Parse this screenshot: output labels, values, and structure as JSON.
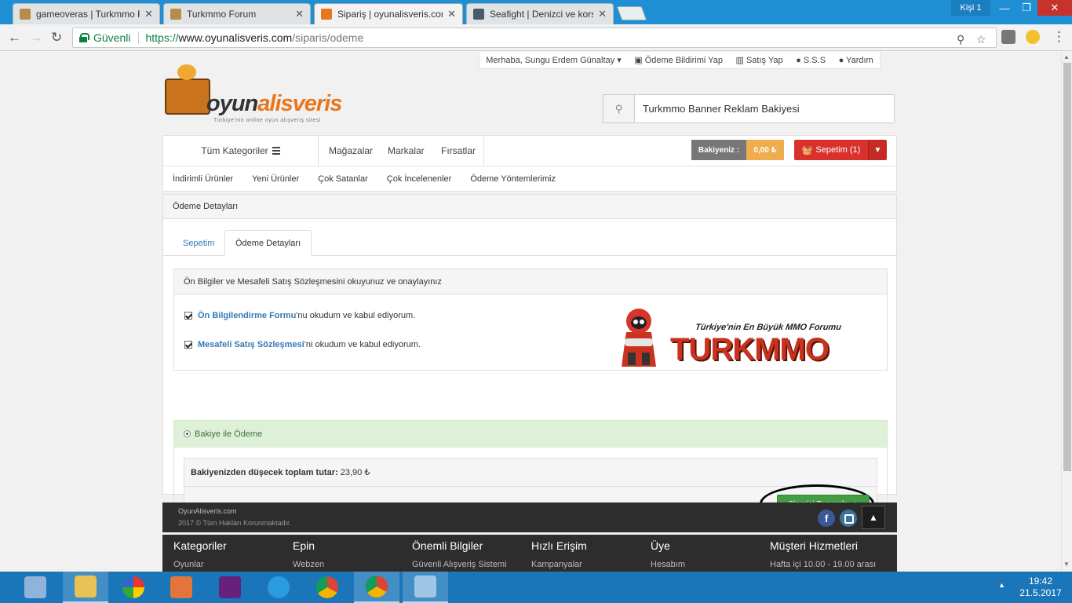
{
  "browser": {
    "tabs": [
      {
        "label": "gameoveras | Turkmmo F",
        "active": false,
        "favicon_color": "#b78c4a"
      },
      {
        "label": "Turkmmo Forum",
        "active": false,
        "favicon_color": "#b78c4a"
      },
      {
        "label": "Sipariş | oyunalisveris.com",
        "active": true,
        "favicon_color": "#e8761d"
      },
      {
        "label": "Seafight | Denizci ve kors",
        "active": false,
        "favicon_color": "#4a5a6a"
      }
    ],
    "profile_label": "Kişi 1",
    "secure_label": "Güvenli",
    "url_scheme": "https://",
    "url_host": "www.oyunalisveris.com",
    "url_path": "/siparis/odeme"
  },
  "site": {
    "top_links": [
      "Merhaba, Sungu Erdem Günaltay ▾",
      "▣ Ödeme Bildirimi Yap",
      "▥ Satış Yap",
      "● S.S.S",
      "● Yardım"
    ],
    "logo": {
      "word_a": "oyun",
      "word_b": "alisveris",
      "tagline": "Türkiye'nin online oyun alışveriş sitesi"
    },
    "search": {
      "value": "Turkmmo Banner Reklam Bakiyesi"
    },
    "nav": {
      "categories_label": "Tüm Kategoriler",
      "links": [
        "Mağazalar",
        "Markalar",
        "Fırsatlar"
      ],
      "balance_label": "Bakiyeniz :",
      "balance_value": "0,00 ₺",
      "cart_label": "Sepetim (1)"
    },
    "subnav": [
      "İndirimli Ürünler",
      "Yeni Ürünler",
      "Çok Satanlar",
      "Çok İncelenenler",
      "Ödeme Yöntemlerimiz"
    ]
  },
  "panel": {
    "heading": "Ödeme Detayları",
    "tabs": {
      "cart": "Sepetim",
      "details": "Ödeme Detayları"
    },
    "agreement": {
      "heading": "Ön Bilgiler ve Mesafeli Satış Sözleşmesini okuyunuz ve onaylayınız",
      "row1_link": "Ön Bilgilendirme Formu",
      "row1_text": "'nu okudum ve kabul ediyorum.",
      "row2_link": "Mesafeli Satış Sözleşmesi",
      "row2_text": "'ni okudum ve kabul ediyorum."
    },
    "banner": {
      "tagline": "Türkiye'nin En Büyük MMO Forumu",
      "word": "TURKMMO"
    },
    "payment": {
      "method_label": "Bakiye ile Ödeme",
      "total_label": "Bakiyenizden düşecek toplam tutar:",
      "total_value": "23,90 ₺",
      "complete_button": "Siparişi Tamamla"
    }
  },
  "footer": {
    "site_name": "OyunAlisveris.com",
    "copyright": "2017 © Tüm Hakları Korunmaktadır.",
    "columns": [
      {
        "heading": "Kategoriler",
        "item": "Oyunlar"
      },
      {
        "heading": "Epin",
        "item": "Webzen"
      },
      {
        "heading": "Önemli Bilgiler",
        "item": "Güvenli Alışveriş Sistemi"
      },
      {
        "heading": "Hızlı Erişim",
        "item": "Kampanyalar"
      },
      {
        "heading": "Üye",
        "item": "Hesabım"
      },
      {
        "heading": "Müşteri Hizmetleri",
        "item": "Hafta içi 10.00 - 19.00 arası"
      }
    ]
  },
  "taskbar": {
    "time": "19:42",
    "date": "21.5.2017"
  }
}
